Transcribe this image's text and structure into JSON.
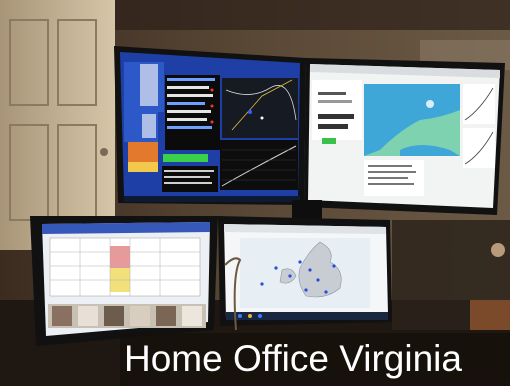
{
  "photo": {
    "caption": "Home Office Virginia",
    "subject": "desk-with-four-monitors"
  },
  "colors": {
    "wall": "#4a3a2c",
    "door": "#c9b89c",
    "monitor_bezel": "#111111",
    "blue_console": "#1e3fa6",
    "map_ocean": "#3fa7d8",
    "caption_text": "#ffffff"
  }
}
